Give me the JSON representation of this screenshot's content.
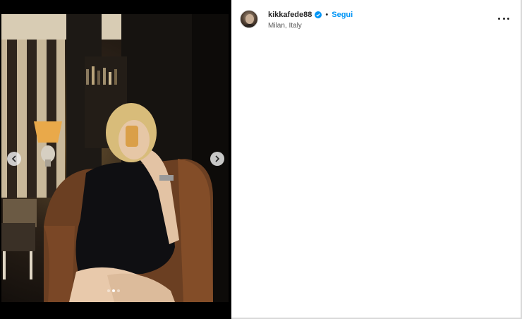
{
  "post": {
    "username": "kikkafede88",
    "separator": "•",
    "follow_label": "Segui",
    "location": "Milan, Italy",
    "verified": true
  },
  "media": {
    "carousel_count": 3,
    "carousel_active_index": 1,
    "icons": {
      "prev": "chevron-left-icon",
      "next": "chevron-right-icon",
      "more": "more-options-icon",
      "verified": "verified-badge-icon"
    }
  },
  "colors": {
    "accent": "#0095f6",
    "text": "#262626",
    "subtext": "#595959",
    "background": "#ffffff",
    "media_bg": "#000000"
  }
}
